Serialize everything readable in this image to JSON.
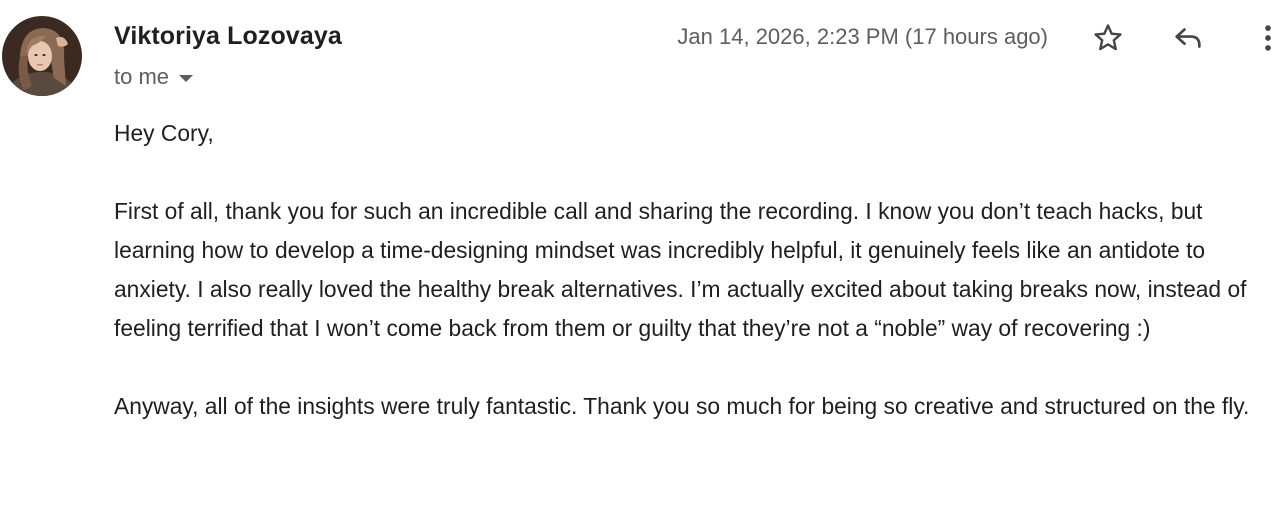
{
  "sender": {
    "name": "Viktoriya Lozovaya",
    "recipient": "to me",
    "avatar_icon": "profile-photo"
  },
  "header": {
    "timestamp": "Jan 14, 2026, 2:23 PM (17 hours ago)",
    "actions": {
      "star_icon": "star-outline-icon",
      "reply_icon": "reply-arrow-icon",
      "more_icon": "more-vertical-icon"
    }
  },
  "message": {
    "greeting": "Hey Cory,",
    "paragraph1": "First of all, thank you for such an incredible call and sharing the recording. I know you don’t teach hacks, but learning how to develop a time-designing mindset was incredibly helpful, it genuinely feels like an antidote to anxiety. I also really loved the healthy break alternatives. I’m actually excited about taking breaks now, instead of feeling terrified that I won’t come back from them or guilty that they’re not a “noble” way of recovering :)",
    "paragraph2": "Anyway, all of the insights were truly fantastic. Thank you so much for being so creative and structured on the fly."
  },
  "colors": {
    "text_primary": "#1f1f1f",
    "text_secondary": "#5e5e5e",
    "icon": "#444746"
  }
}
